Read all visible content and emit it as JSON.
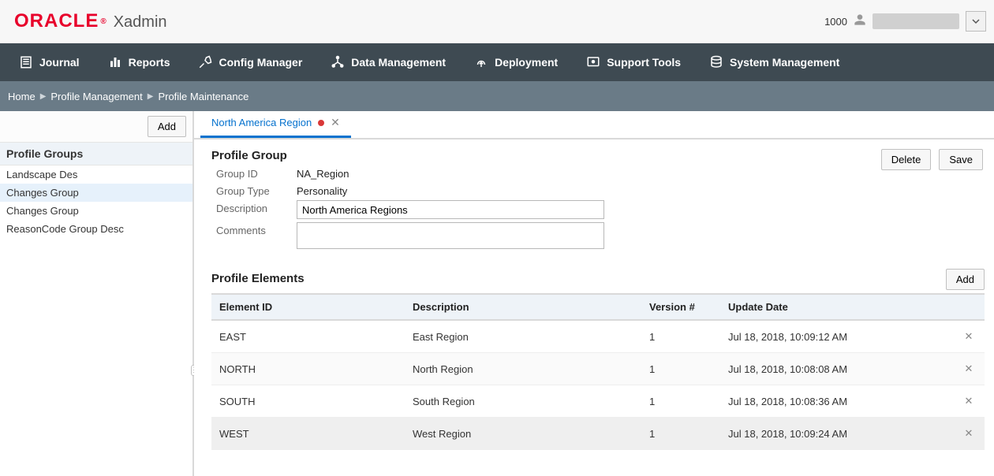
{
  "header": {
    "brand_primary": "ORACLE",
    "brand_suffix": "®",
    "app_title": "Xadmin",
    "tenant_id": "1000"
  },
  "nav": {
    "items": [
      {
        "id": "journal",
        "label": "Journal"
      },
      {
        "id": "reports",
        "label": "Reports"
      },
      {
        "id": "config-manager",
        "label": "Config Manager"
      },
      {
        "id": "data-management",
        "label": "Data Management"
      },
      {
        "id": "deployment",
        "label": "Deployment"
      },
      {
        "id": "support-tools",
        "label": "Support Tools"
      },
      {
        "id": "system-management",
        "label": "System Management"
      }
    ]
  },
  "breadcrumb": {
    "items": [
      "Home",
      "Profile Management",
      "Profile Maintenance"
    ]
  },
  "sidebar": {
    "add_label": "Add",
    "heading": "Profile Groups",
    "items": [
      {
        "label": "Landscape Des",
        "selected": false
      },
      {
        "label": "Changes Group",
        "selected": true
      },
      {
        "label": "Changes Group",
        "selected": false
      },
      {
        "label": "ReasonCode Group Desc",
        "selected": false
      }
    ]
  },
  "tabs": {
    "active": {
      "label": "North America Region",
      "dirty": true
    }
  },
  "profile_group": {
    "section_title": "Profile Group",
    "labels": {
      "group_id": "Group ID",
      "group_type": "Group Type",
      "description": "Description",
      "comments": "Comments"
    },
    "values": {
      "group_id": "NA_Region",
      "group_type": "Personality",
      "description": "North America Regions",
      "comments": ""
    },
    "buttons": {
      "delete": "Delete",
      "save": "Save"
    }
  },
  "profile_elements": {
    "section_title": "Profile Elements",
    "add_label": "Add",
    "columns": {
      "element_id": "Element ID",
      "description": "Description",
      "version": "Version #",
      "update_date": "Update Date"
    },
    "rows": [
      {
        "element_id": "EAST",
        "description": "East Region",
        "version": "1",
        "update_date": "Jul 18, 2018, 10:09:12 AM"
      },
      {
        "element_id": "NORTH",
        "description": "North Region",
        "version": "1",
        "update_date": "Jul 18, 2018, 10:08:08 AM"
      },
      {
        "element_id": "SOUTH",
        "description": "South Region",
        "version": "1",
        "update_date": "Jul 18, 2018, 10:08:36 AM"
      },
      {
        "element_id": "WEST",
        "description": "West Region",
        "version": "1",
        "update_date": "Jul 18, 2018, 10:09:24 AM"
      }
    ]
  }
}
